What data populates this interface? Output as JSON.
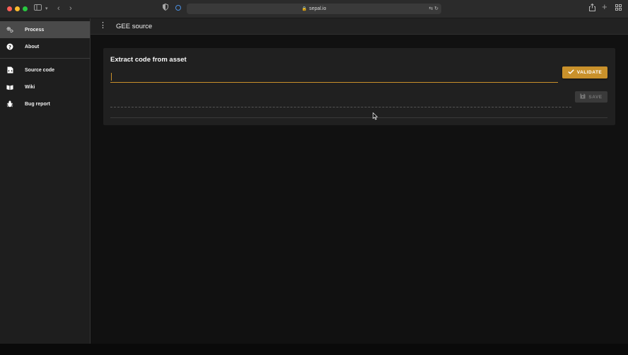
{
  "browser": {
    "url": "sepal.io"
  },
  "sidebar": {
    "items": [
      {
        "label": "Process",
        "icon": "gears-icon",
        "active": true
      },
      {
        "label": "About",
        "icon": "question-icon",
        "active": false
      }
    ],
    "links": [
      {
        "label": "Source code",
        "icon": "file-code-icon"
      },
      {
        "label": "Wiki",
        "icon": "book-icon"
      },
      {
        "label": "Bug report",
        "icon": "bug-icon"
      }
    ]
  },
  "header": {
    "title": "GEE source"
  },
  "panel": {
    "title": "Extract code from asset",
    "asset_input_value": "",
    "validate_label": "VALIDATE",
    "save_label": "SAVE"
  },
  "colors": {
    "accent": "#c9912b",
    "sidebar_bg": "#1e1e1e",
    "panel_bg": "#202020"
  }
}
